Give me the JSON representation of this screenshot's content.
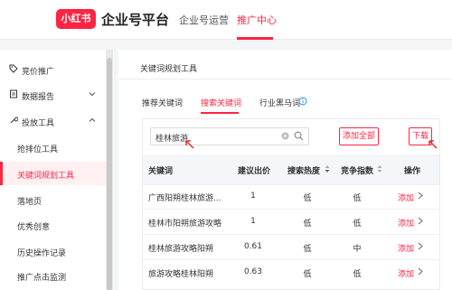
{
  "header": {
    "logo": "小红书",
    "platform": "企业号平台",
    "nav": [
      "企业号运营",
      "推广中心"
    ],
    "active_nav": "推广中心"
  },
  "sidebar": {
    "items": [
      {
        "label": "竞价推广",
        "icon": "tag-icon"
      },
      {
        "label": "数据报告",
        "icon": "report-icon"
      },
      {
        "label": "投放工具",
        "icon": "tool-icon"
      },
      {
        "label": "抢排位工具"
      },
      {
        "label": "关键词规划工具"
      },
      {
        "label": "落地页"
      },
      {
        "label": "优秀创意"
      },
      {
        "label": "历史操作记录"
      },
      {
        "label": "推广点击监测"
      }
    ],
    "active_item": "关键词规划工具"
  },
  "card": {
    "title": "关键词规划工具",
    "tabs": [
      "推荐关键词",
      "搜索关键词",
      "行业黑马词"
    ],
    "active_tab": "搜索关键词"
  },
  "search": {
    "value": "桂林旅游"
  },
  "buttons": {
    "add_all": "添加全部",
    "download": "下载"
  },
  "table": {
    "headers": [
      "关键词",
      "建议出价",
      "搜索热度",
      "竞争指数",
      "操作"
    ],
    "rows": [
      {
        "keyword": "广西阳朔桂林旅游...",
        "bid": "1",
        "heat": "低",
        "competition": "低",
        "action": "添加"
      },
      {
        "keyword": "桂林市阳朔旅游攻略",
        "bid": "1",
        "heat": "低",
        "competition": "低",
        "action": "添加"
      },
      {
        "keyword": "桂林旅游攻略阳朔",
        "bid": "0.61",
        "heat": "低",
        "competition": "中",
        "action": "添加"
      },
      {
        "keyword": "旅游攻略桂林阳朔",
        "bid": "0.63",
        "heat": "低",
        "competition": "低",
        "action": "添加"
      }
    ]
  },
  "colors": {
    "accent": "#ff2442",
    "arrow": "#e0312b"
  }
}
